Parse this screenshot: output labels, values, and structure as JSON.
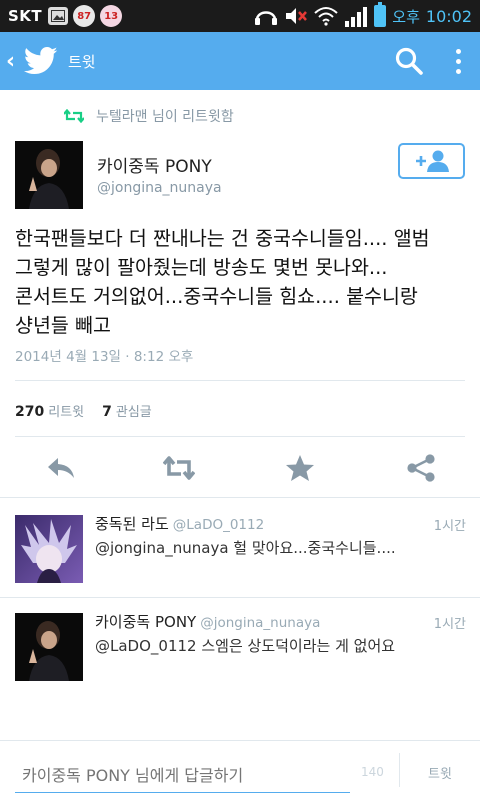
{
  "status_bar": {
    "carrier": "SKT",
    "badge_1": "87",
    "badge_2": "13",
    "ampm": "오후",
    "time": "10:02"
  },
  "header": {
    "title": "트윗"
  },
  "retweet_context": "누텔라맨 님이 리트윗함",
  "tweet": {
    "author_name": "카이중독 PONY",
    "author_handle": "@jongina_nunaya",
    "text_lines": [
      "한국팬들보다 더 짠내나는 건 중국수니들임.... 앨범",
      "그렇게 많이 팔아줬는데 방송도 몇번 못나와...",
      "콘서트도 거의없어...중국수니들 힘쇼.... 붙수니랑",
      "샹년들 빼고"
    ],
    "timestamp": "2014년 4월 13일 · 8:12 오후",
    "retweet_count": "270",
    "retweet_label": "리트윗",
    "favorite_count": "7",
    "favorite_label": "관심글"
  },
  "icons": {
    "back": "back-chevron-icon",
    "logo": "twitter-bird-icon",
    "search": "search-icon",
    "overflow": "overflow-menu-icon",
    "follow": "add-user-icon",
    "reply": "reply-icon",
    "retweet": "retweet-icon",
    "favorite": "star-icon",
    "share": "share-icon"
  },
  "replies": [
    {
      "name": "중독된 라도",
      "handle": "@LaDO_0112",
      "time": "1시간",
      "text": "@jongina_nunaya 헐 맞아요...중국수니들...."
    },
    {
      "name": "카이중독 PONY",
      "handle": "@jongina_nunaya",
      "time": "1시간",
      "text": "@LaDO_0112 스엠은 상도덕이라는 게 없어요"
    }
  ],
  "compose": {
    "placeholder": "카이중독 PONY 님에게 답글하기",
    "char_count": "140",
    "send_label": "트윗"
  },
  "colors": {
    "brand": "#55acee",
    "status_bar": "#1b1b1b",
    "muted_text": "#8899a6",
    "retweet_green": "#19cf86"
  }
}
